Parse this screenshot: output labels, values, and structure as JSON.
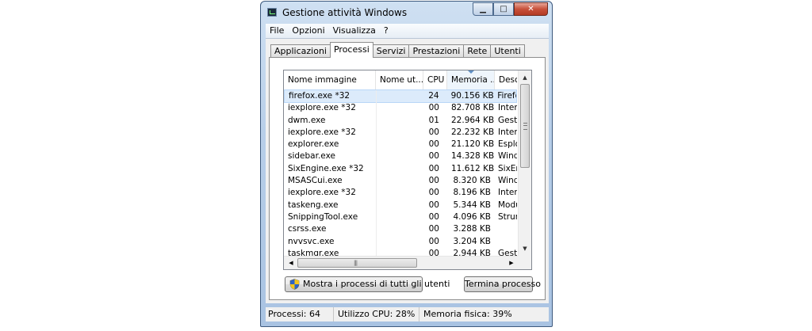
{
  "window": {
    "title": "Gestione attività Windows",
    "minimize_glyph": "▁",
    "maximize_glyph": "□",
    "close_glyph": "✕"
  },
  "menu": [
    "File",
    "Opzioni",
    "Visualizza",
    "?"
  ],
  "tabs": [
    {
      "label": "Applicazioni",
      "active": false
    },
    {
      "label": "Processi",
      "active": true
    },
    {
      "label": "Servizi",
      "active": false
    },
    {
      "label": "Prestazioni",
      "active": false
    },
    {
      "label": "Rete",
      "active": false
    },
    {
      "label": "Utenti",
      "active": false
    }
  ],
  "process_table": {
    "columns": [
      "Nome immagine",
      "Nome ut...",
      "CPU",
      "Memoria ...",
      "Descri"
    ],
    "sorted_column": "Memoria ...",
    "rows": [
      {
        "name": "firefox.exe *32",
        "user": "",
        "cpu": "24",
        "memory": "90.156 KB",
        "description": "Firefo",
        "selected": true
      },
      {
        "name": "iexplore.exe *32",
        "user": "",
        "cpu": "00",
        "memory": "82.708 KB",
        "description": "Interr",
        "selected": false
      },
      {
        "name": "dwm.exe",
        "user": "",
        "cpu": "01",
        "memory": "22.964 KB",
        "description": "Gestic",
        "selected": false
      },
      {
        "name": "iexplore.exe *32",
        "user": "",
        "cpu": "00",
        "memory": "22.232 KB",
        "description": "Interr",
        "selected": false
      },
      {
        "name": "explorer.exe",
        "user": "",
        "cpu": "00",
        "memory": "21.120 KB",
        "description": "Esplor",
        "selected": false
      },
      {
        "name": "sidebar.exe",
        "user": "",
        "cpu": "00",
        "memory": "14.328 KB",
        "description": "Windo",
        "selected": false
      },
      {
        "name": "SixEngine.exe *32",
        "user": "",
        "cpu": "00",
        "memory": "11.612 KB",
        "description": "SixEng",
        "selected": false
      },
      {
        "name": "MSASCui.exe",
        "user": "",
        "cpu": "00",
        "memory": "8.320 KB",
        "description": "Windo",
        "selected": false
      },
      {
        "name": "iexplore.exe *32",
        "user": "",
        "cpu": "00",
        "memory": "8.196 KB",
        "description": "Interr",
        "selected": false
      },
      {
        "name": "taskeng.exe",
        "user": "",
        "cpu": "00",
        "memory": "5.344 KB",
        "description": "Modul",
        "selected": false
      },
      {
        "name": "SnippingTool.exe",
        "user": "",
        "cpu": "00",
        "memory": "4.096 KB",
        "description": "Strum",
        "selected": false
      },
      {
        "name": "csrss.exe",
        "user": "",
        "cpu": "00",
        "memory": "3.288 KB",
        "description": "",
        "selected": false
      },
      {
        "name": "nvvsvc.exe",
        "user": "",
        "cpu": "00",
        "memory": "3.204 KB",
        "description": "",
        "selected": false
      },
      {
        "name": "taskmgr.exe",
        "user": "",
        "cpu": "00",
        "memory": "2.944 KB",
        "description": "Gestic",
        "selected": false
      }
    ]
  },
  "scrollbars": {
    "up_glyph": "▲",
    "down_glyph": "▼",
    "left_glyph": "◀",
    "right_glyph": "▶",
    "grip_glyph": "|||"
  },
  "buttons": {
    "show_all": "Mostra i processi di tutti gli utenti",
    "end_process": "Termina processo"
  },
  "status": {
    "processes": "Processi: 64",
    "cpu": "Utilizzo CPU: 28%",
    "memory": "Memoria fisica: 39%"
  },
  "colors": {
    "selection": "#dcebfb",
    "close_button": "#c8503a",
    "window_frame": "#b8cfe9"
  },
  "icons": {
    "app": "task-manager-icon",
    "shield": "uac-shield-icon"
  }
}
